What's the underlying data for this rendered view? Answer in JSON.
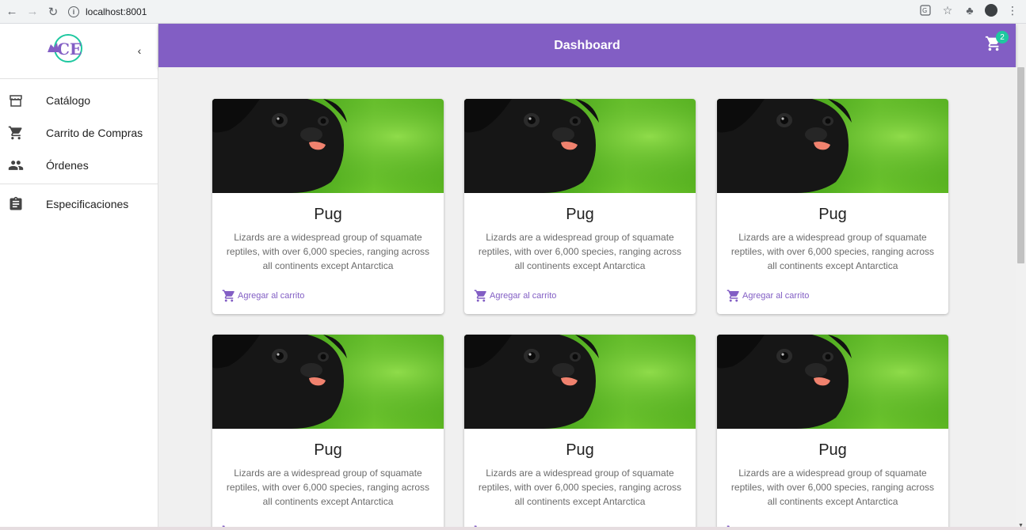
{
  "browser": {
    "url": "localhost:8001",
    "back_icon": "arrow-left-icon",
    "forward_icon": "arrow-right-icon",
    "reload_icon": "reload-icon"
  },
  "sidebar": {
    "collapse_icon": "chevron-left-icon",
    "logo_text": "CE",
    "items": [
      {
        "label": "Catálogo",
        "icon": "store-icon"
      },
      {
        "label": "Carrito de Compras",
        "icon": "cart-icon"
      },
      {
        "label": "Órdenes",
        "icon": "people-icon"
      },
      {
        "label": "Especificaciones",
        "icon": "clipboard-icon"
      }
    ]
  },
  "appbar": {
    "title": "Dashboard",
    "cart_count": "2"
  },
  "colors": {
    "accent": "#825ec4",
    "badge": "#1ec8a0"
  },
  "cards": [
    {
      "title": "Pug",
      "description": "Lizards are a widespread group of squamate reptiles, with over 6,000 species, ranging across all continents except Antarctica",
      "action": "Agregar al carrito"
    },
    {
      "title": "Pug",
      "description": "Lizards are a widespread group of squamate reptiles, with over 6,000 species, ranging across all continents except Antarctica",
      "action": "Agregar al carrito"
    },
    {
      "title": "Pug",
      "description": "Lizards are a widespread group of squamate reptiles, with over 6,000 species, ranging across all continents except Antarctica",
      "action": "Agregar al carrito"
    },
    {
      "title": "Pug",
      "description": "Lizards are a widespread group of squamate reptiles, with over 6,000 species, ranging across all continents except Antarctica",
      "action": "Agregar al carrito"
    },
    {
      "title": "Pug",
      "description": "Lizards are a widespread group of squamate reptiles, with over 6,000 species, ranging across all continents except Antarctica",
      "action": "Agregar al carrito"
    },
    {
      "title": "Pug",
      "description": "Lizards are a widespread group of squamate reptiles, with over 6,000 species, ranging across all continents except Antarctica",
      "action": "Agregar al carrito"
    }
  ]
}
